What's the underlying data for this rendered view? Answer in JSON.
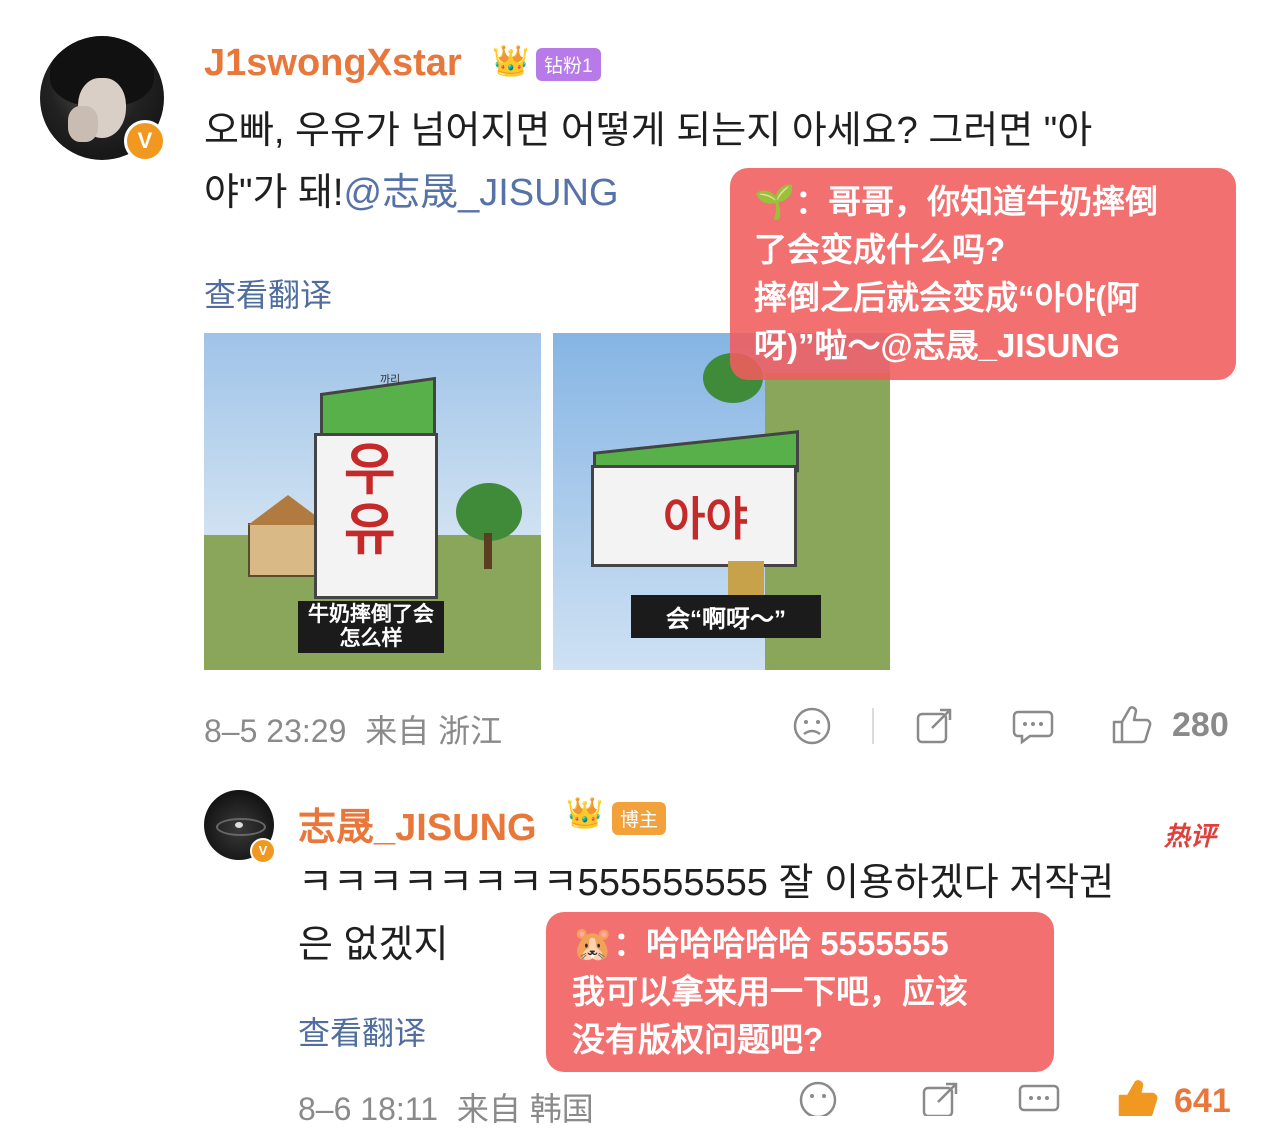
{
  "post": {
    "username": "J1swongXstar",
    "fan_badge": "钻粉1",
    "text_line1": "오빠, 우유가 넘어지면 어떻게 되는지 아세요? 그러면 \"아",
    "text_line2": "야\"가 돼!",
    "mention": "@志晟_JISUNG",
    "translate_label": "查看翻译",
    "overlay_line1": "🌱：哥哥，你知道牛奶摔倒",
    "overlay_line2": "了会变成什么吗?",
    "overlay_line3": "摔倒之后就会变成“아야(阿",
    "overlay_line4": "呀)”啦～@志晟_JISUNG",
    "image1": {
      "brand": "까리",
      "hangul_top": "우",
      "hangul_bottom": "유",
      "caption_line1": "牛奶摔倒了会",
      "caption_line2": "怎么样"
    },
    "image2": {
      "hangul": "아야",
      "caption": "会“啊呀～”"
    },
    "time": "8–5 23:29",
    "source": "来自 浙江",
    "likes": "280"
  },
  "reply": {
    "username": "志晟_JISUNG",
    "host_badge": "博主",
    "hot_tag": "热评",
    "text_line1": "ㅋㅋㅋㅋㅋㅋㅋㅋ555555555 잘 이용하겠다 저작권",
    "text_line2": "은 없겠지",
    "translate_label": "查看翻译",
    "overlay_line1": "🐹：哈哈哈哈哈 5555555",
    "overlay_line2": "我可以拿来用一下吧，应该",
    "overlay_line3": "没有版权问题吧?",
    "time": "8–6 18:11",
    "source": "来自 韩国",
    "likes": "641"
  },
  "icons": [
    "verified-icon",
    "crown-icon",
    "dislike-icon",
    "share-icon",
    "comment-icon",
    "like-icon"
  ],
  "colors": {
    "username": "#e8773c",
    "mention": "#5672a8",
    "overlay": "#f05c5c",
    "fan_badge": "#b87ae8",
    "host_badge": "#f3a23b",
    "hot": "#e0403c"
  }
}
